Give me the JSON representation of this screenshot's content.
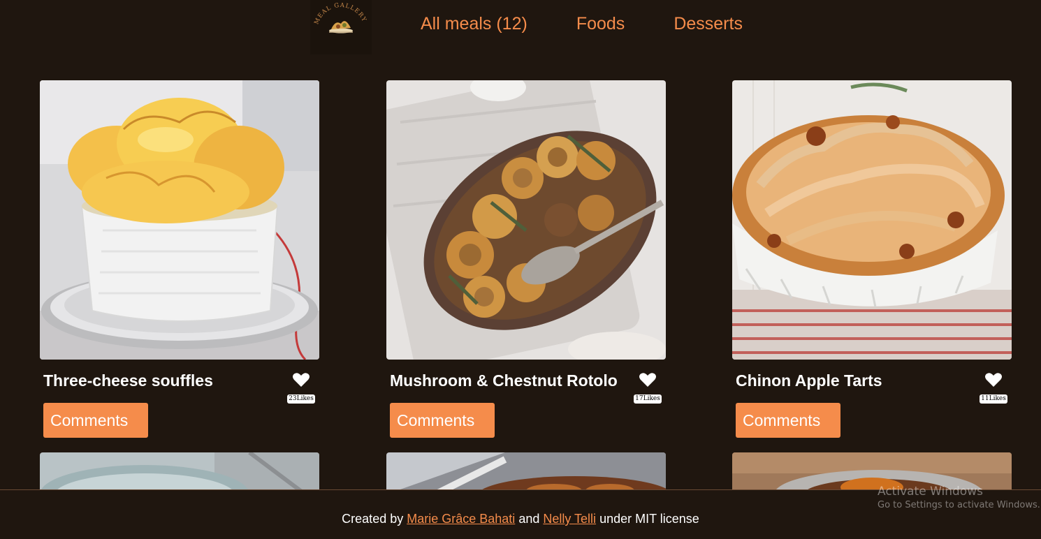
{
  "logo": {
    "text": "MEAL GALLERY"
  },
  "nav": {
    "items": [
      {
        "label": "All meals (12)"
      },
      {
        "label": "Foods"
      },
      {
        "label": "Desserts"
      }
    ]
  },
  "meals": [
    {
      "title": "Three-cheese souffles",
      "likes": "23Likes",
      "comments_label": "Comments"
    },
    {
      "title": "Mushroom & Chestnut Rotolo",
      "likes": "17Likes",
      "comments_label": "Comments"
    },
    {
      "title": "Chinon Apple Tarts",
      "likes": "11Likes",
      "comments_label": "Comments"
    }
  ],
  "footer": {
    "prefix": "Created by ",
    "author1": "Marie Grâce Bahati",
    "middle": " and ",
    "author2": "Nelly Telli",
    "suffix": " under MIT license"
  },
  "watermark": {
    "line1": "Activate Windows",
    "line2": "Go to Settings to activate Windows."
  },
  "colors": {
    "background": "#1f160f",
    "accent": "#f58c4b",
    "text": "#ffffff"
  },
  "icons": {
    "like": "heart-icon",
    "logo": "meal-gallery-logo"
  }
}
